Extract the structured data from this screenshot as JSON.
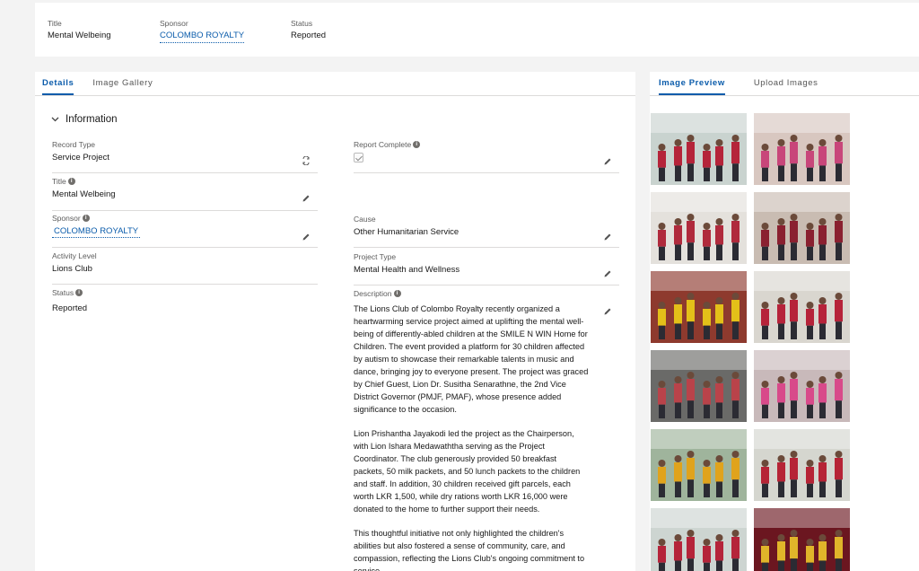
{
  "header": {
    "title_label": "Title",
    "title_value": "Mental Welbeing",
    "sponsor_label": "Sponsor",
    "sponsor_value": "COLOMBO ROYALTY",
    "status_label": "Status",
    "status_value": "Reported"
  },
  "main_tabs": {
    "details": "Details",
    "gallery": "Image Gallery"
  },
  "side_tabs": {
    "preview": "Image Preview",
    "upload": "Upload Images"
  },
  "section": {
    "title": "Information"
  },
  "fields": {
    "record_type": {
      "label": "Record Type",
      "value": "Service Project"
    },
    "report_complete": {
      "label": "Report Complete"
    },
    "title": {
      "label": "Title",
      "value": "Mental Welbeing"
    },
    "sponsor": {
      "label": "Sponsor",
      "value": "COLOMBO ROYALTY"
    },
    "cause": {
      "label": "Cause",
      "value": "Other Humanitarian Service"
    },
    "activity_level": {
      "label": "Activity Level",
      "value": "Lions Club"
    },
    "project_type": {
      "label": "Project Type",
      "value": "Mental Health and Wellness"
    },
    "status": {
      "label": "Status",
      "value": "Reported"
    },
    "description": {
      "label": "Description",
      "p1": "The Lions Club of Colombo Royalty recently organized a heartwarming service project aimed at uplifting the mental well-being of differently-abled children at the SMILE N WIN Home for Children. The event provided a platform for 30 children affected by autism to showcase their remarkable talents in music and dance, bringing joy to everyone present. The project was graced by Chief Guest, Lion Dr. Susitha Senarathne, the 2nd Vice District Governor (PMJF, PMAF), whose presence added significance to the occasion.",
      "p2": "Lion Prishantha Jayakodi led the project as the Chairperson, with Lion Ishara Medawaththa serving as the Project Coordinator. The club generously provided 50 breakfast packets, 50 milk packets, and 50 lunch packets to the children and staff. In addition, 30 children received gift parcels, each worth LKR 1,500, while dry rations worth LKR 16,000 were donated to the home to further support their needs.",
      "p3": "This thoughtful initiative not only highlighted the children's abilities but also fostered a sense of community, care, and compassion, reflecting the Lions Club's ongoing commitment to service."
    }
  },
  "photos": [
    {
      "name": "photo-group-red-shirts",
      "bg": "#c9d3cf",
      "accent": "#b5243a"
    },
    {
      "name": "photo-event-crowd",
      "bg": "#d8c7c0",
      "accent": "#c8467a"
    },
    {
      "name": "photo-gift-handover",
      "bg": "#e4e1dc",
      "accent": "#b02a3c"
    },
    {
      "name": "photo-hall-performance",
      "bg": "#c9bcb2",
      "accent": "#8a2030"
    },
    {
      "name": "photo-dance-yellow",
      "bg": "#8e3a2e",
      "accent": "#e3c019"
    },
    {
      "name": "photo-stage-dance",
      "bg": "#d9d6cf",
      "accent": "#b6233a"
    },
    {
      "name": "photo-doorway",
      "bg": "#6a6a68",
      "accent": "#b9434a"
    },
    {
      "name": "photo-children-pink",
      "bg": "#c8b9ba",
      "accent": "#d84a8a"
    },
    {
      "name": "photo-speech-outdoor",
      "bg": "#9fb49c",
      "accent": "#e0a31c"
    },
    {
      "name": "photo-group-outdoor",
      "bg": "#d5d6cf",
      "accent": "#b62436"
    },
    {
      "name": "photo-group-red-shirts-2",
      "bg": "#cdd5d1",
      "accent": "#b5243a"
    },
    {
      "name": "photo-lions-banner",
      "bg": "#6b1620",
      "accent": "#e0b52a"
    }
  ]
}
